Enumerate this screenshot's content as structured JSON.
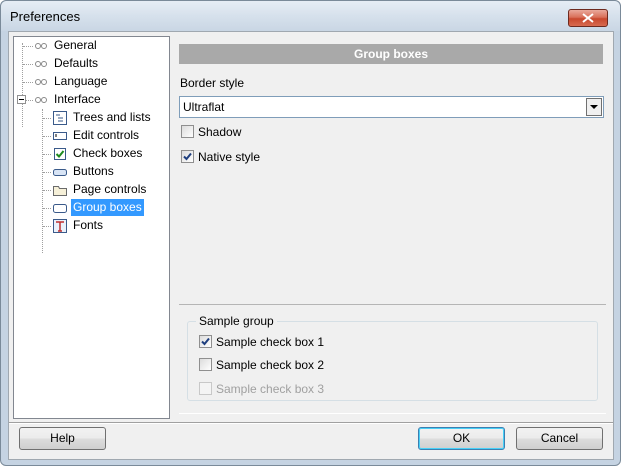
{
  "window": {
    "title": "Preferences"
  },
  "tree": {
    "items": [
      {
        "label": "General"
      },
      {
        "label": "Defaults"
      },
      {
        "label": "Language"
      },
      {
        "label": "Interface"
      },
      {
        "label": "Trees and lists"
      },
      {
        "label": "Edit controls"
      },
      {
        "label": "Check boxes"
      },
      {
        "label": "Buttons"
      },
      {
        "label": "Page controls"
      },
      {
        "label": "Group boxes",
        "selected": true
      },
      {
        "label": "Fonts"
      }
    ]
  },
  "panel": {
    "header": "Group boxes",
    "border_style_label": "Border style",
    "border_style_value": "Ultraflat",
    "shadow_label": "Shadow",
    "shadow_checked": false,
    "native_style_label": "Native style",
    "native_style_checked": true
  },
  "sample": {
    "group_title": "Sample group",
    "checkboxes": [
      {
        "label": "Sample check box 1",
        "checked": true,
        "enabled": true
      },
      {
        "label": "Sample check box 2",
        "checked": false,
        "enabled": true
      },
      {
        "label": "Sample check box 3",
        "checked": false,
        "enabled": false
      }
    ]
  },
  "buttons": {
    "help": "Help",
    "ok": "OK",
    "cancel": "Cancel"
  },
  "colors": {
    "selection": "#3399ff",
    "header_bg": "#a9a9a9"
  }
}
